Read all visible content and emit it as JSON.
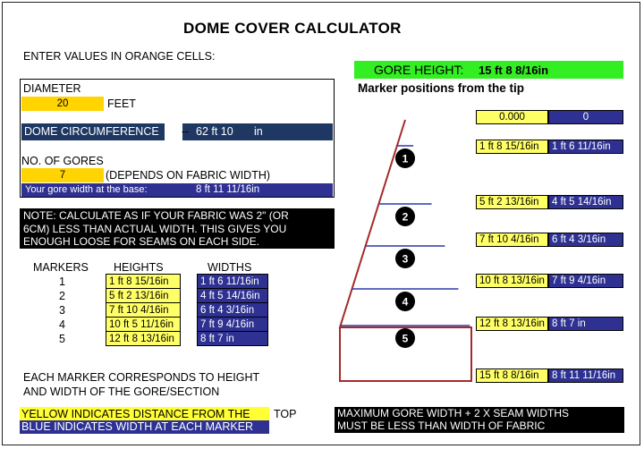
{
  "title": "DOME COVER CALCULATOR",
  "instruction": "ENTER VALUES IN ORANGE CELLS:",
  "diameter": {
    "label": "DIAMETER",
    "value": "20",
    "unit": "FEET"
  },
  "circumference": {
    "label": "DOME CIRCUMFERENCE",
    "arrow": "--",
    "value": "62 ft 10",
    "unit": "in"
  },
  "gores": {
    "label": "NO. OF GORES",
    "value": "7",
    "note": "(DEPENDS ON FABRIC WIDTH)"
  },
  "gore_width": {
    "label": "Your gore width at the base:",
    "value": "8 ft 11 11/16in"
  },
  "note": [
    "NOTE: CALCULATE AS IF YOUR FABRIC WAS 2\" (OR",
    "6CM) LESS THAN ACTUAL WIDTH. THIS GIVES YOU",
    "ENOUGH LOOSE FOR SEAMS ON EACH SIDE."
  ],
  "table": {
    "headers": [
      "MARKERS",
      "HEIGHTS",
      "WIDTHS"
    ],
    "rows": [
      {
        "marker": "1",
        "height": "1 ft 8 15/16in",
        "width": "1 ft 6 11/16in"
      },
      {
        "marker": "2",
        "height": "5 ft 2 13/16in",
        "width": "4 ft 5 14/16in"
      },
      {
        "marker": "3",
        "height": "7 ft 10  4/16in",
        "width": "6 ft 4  3/16in"
      },
      {
        "marker": "4",
        "height": "10 ft 5 11/16in",
        "width": "7 ft 9  4/16in"
      },
      {
        "marker": "5",
        "height": "12 ft 8 13/16in",
        "width": "8 ft 7      in"
      }
    ]
  },
  "marker_note": [
    "EACH MARKER CORRESPONDS TO HEIGHT",
    "AND WIDTH OF THE GORE/SECTION"
  ],
  "legend": {
    "yellow": "YELLOW INDICATES DISTANCE FROM THE",
    "yellow_rest": "TOP",
    "blue": "BLUE INDICATES WIDTH AT EACH MARKER"
  },
  "gore_height": {
    "label": "GORE HEIGHT:",
    "value": "15 ft 8  8/16in"
  },
  "marker_positions_label": "Marker positions from the tip",
  "diagram": {
    "markers": [
      "1",
      "2",
      "3",
      "4",
      "5"
    ],
    "tip": {
      "height": "0.000",
      "width": "0"
    },
    "labels": [
      {
        "height": "1 ft 8 15/16in",
        "width": "1 ft 6 11/16in"
      },
      {
        "height": "5 ft 2 13/16in",
        "width": "4 ft 5 14/16in"
      },
      {
        "height": "7 ft 10  4/16in",
        "width": "6 ft 4  3/16in"
      },
      {
        "height": "10 ft 8 13/16in",
        "width": "7 ft 9  4/16in"
      },
      {
        "height": "12 ft 8 13/16in",
        "width": "8 ft 7      in"
      },
      {
        "height": "15 ft 8  8/16in",
        "width": "8 ft 11 11/16in"
      }
    ]
  },
  "warning": [
    "MAXIMUM GORE WIDTH + 2 X SEAM WIDTHS",
    "MUST BE LESS THAN WIDTH OF FABRIC"
  ],
  "colors": {
    "yellow": "#ffd400",
    "light_yellow": "#ffff66",
    "navy": "#1f3863",
    "blue": "#2e3192",
    "green": "#33ee22",
    "gore_outline": "#a52a2a",
    "marker_line": "#2b3aa8"
  }
}
